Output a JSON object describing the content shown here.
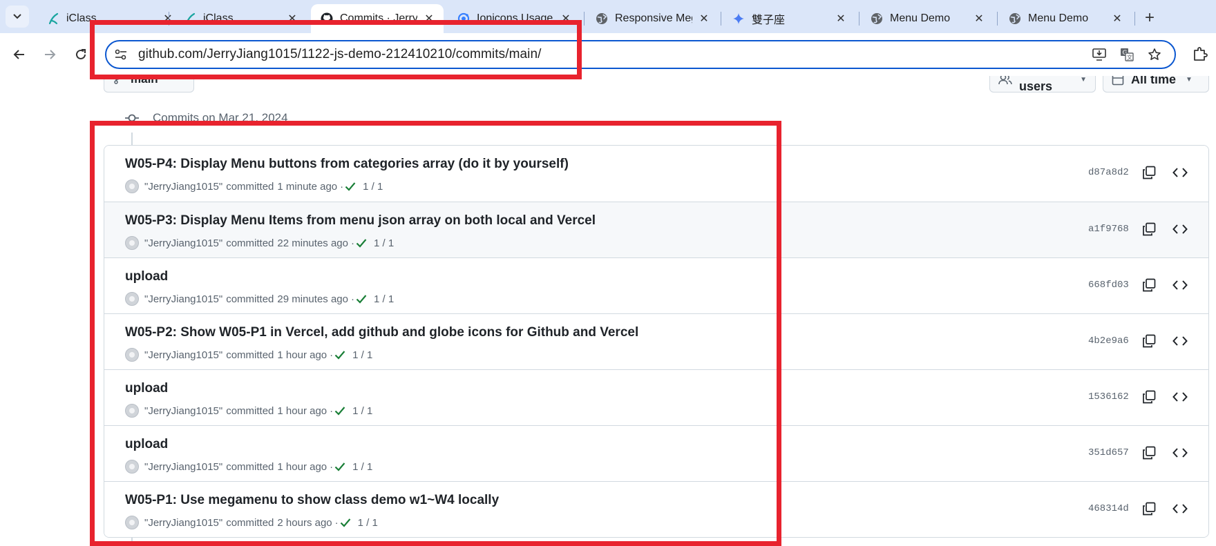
{
  "browser": {
    "tabs": [
      {
        "title": "iClass",
        "icon": "iclass-icon"
      },
      {
        "title": "iClass",
        "icon": "iclass-icon"
      },
      {
        "title": "Commits · Jerry",
        "icon": "github-icon",
        "active": true
      },
      {
        "title": "Ionicons Usage",
        "icon": "ionicons-icon"
      },
      {
        "title": "Responsive Meg",
        "icon": "globe-icon"
      },
      {
        "title": "雙子座",
        "icon": "gemini-icon"
      },
      {
        "title": "Menu Demo",
        "icon": "globe-icon"
      },
      {
        "title": "Menu Demo",
        "icon": "globe-icon"
      }
    ],
    "new_tab": "+",
    "address": "github.com/JerryJiang1015/1122-js-demo-212410210/commits/main/"
  },
  "page": {
    "branch_label": "main",
    "filters": {
      "users_label": "All users",
      "time_label": "All time"
    },
    "day_header": "Commits on Mar 21, 2024",
    "commits": [
      {
        "message": "W05-P4: Display Menu buttons from categories array (do it by yourself)",
        "author": "\"JerryJiang1015\"",
        "action": "committed",
        "time": "1 minute ago",
        "status": "1 / 1",
        "sha": "d87a8d2"
      },
      {
        "message": "W05-P3: Display Menu Items from menu json array on both local and Vercel",
        "author": "\"JerryJiang1015\"",
        "action": "committed",
        "time": "22 minutes ago",
        "status": "1 / 1",
        "sha": "a1f9768"
      },
      {
        "message": "upload",
        "author": "\"JerryJiang1015\"",
        "action": "committed",
        "time": "29 minutes ago",
        "status": "1 / 1",
        "sha": "668fd03"
      },
      {
        "message": "W05-P2: Show W05-P1 in Vercel, add github and globe icons for Github and Vercel",
        "author": "\"JerryJiang1015\"",
        "action": "committed",
        "time": "1 hour ago",
        "status": "1 / 1",
        "sha": "4b2e9a6"
      },
      {
        "message": "upload",
        "author": "\"JerryJiang1015\"",
        "action": "committed",
        "time": "1 hour ago",
        "status": "1 / 1",
        "sha": "1536162"
      },
      {
        "message": "upload",
        "author": "\"JerryJiang1015\"",
        "action": "committed",
        "time": "1 hour ago",
        "status": "1 / 1",
        "sha": "351d657"
      },
      {
        "message": "W05-P1: Use megamenu to show class demo w1~W4 locally",
        "author": "\"JerryJiang1015\"",
        "action": "committed",
        "time": "2 hours ago",
        "status": "1 / 1",
        "sha": "468314d"
      }
    ]
  },
  "colors": {
    "annotation": "#e8232e",
    "check": "#1a7f37",
    "accent": "#0b57d0"
  }
}
